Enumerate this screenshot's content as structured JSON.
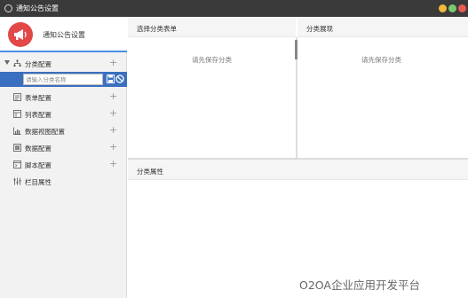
{
  "window": {
    "title": "通知公告设置"
  },
  "app": {
    "name": "通知公告设置",
    "logo_icon": "megaphone-icon",
    "logo_color": "#e24848"
  },
  "sidebar": {
    "category_label": "分类配置",
    "category_input_placeholder": "请输入分类名称",
    "items": [
      {
        "label": "表单配置",
        "icon": "form-icon",
        "has_add": true
      },
      {
        "label": "列表配置",
        "icon": "list-icon",
        "has_add": true
      },
      {
        "label": "数据视图配置",
        "icon": "chart-icon",
        "has_add": true
      },
      {
        "label": "数据配置",
        "icon": "data-icon",
        "has_add": true
      },
      {
        "label": "脚本配置",
        "icon": "script-icon",
        "has_add": true
      },
      {
        "label": "栏目属性",
        "icon": "sliders-icon",
        "has_add": false
      }
    ],
    "add_symbol": "+"
  },
  "panels": {
    "form_select": {
      "title": "选择分类表单",
      "empty_text": "请先保存分类"
    },
    "category_display": {
      "title": "分类展现",
      "empty_text": "请先保存分类"
    },
    "category_props": {
      "title": "分类属性"
    }
  },
  "watermark": "O2OA企业应用开发平台",
  "colors": {
    "accent": "#3b6fbf",
    "header_bar": "#3a3a3a"
  }
}
